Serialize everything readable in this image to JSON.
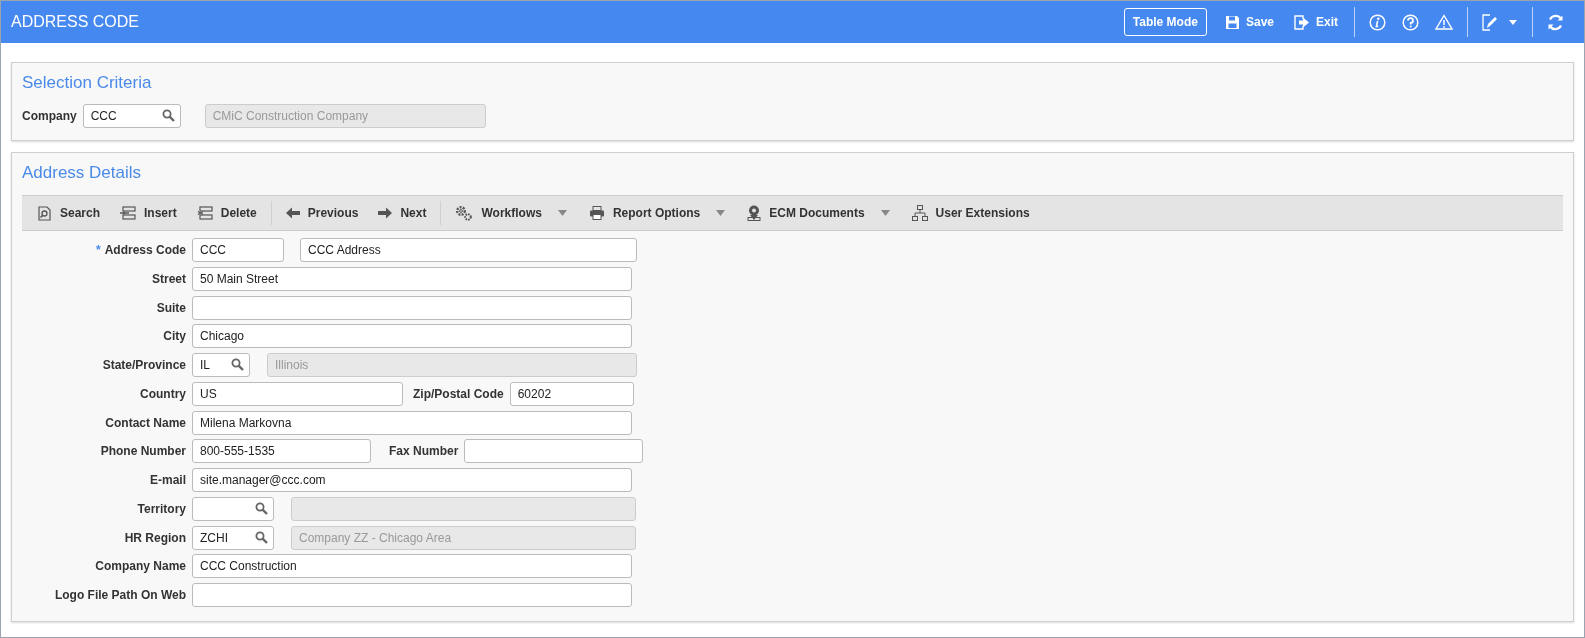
{
  "header": {
    "title": "ADDRESS CODE",
    "actions": [
      {
        "kind": "outlined",
        "label": "Table Mode"
      },
      {
        "kind": "save",
        "label": "Save"
      },
      {
        "kind": "exit",
        "label": "Exit"
      }
    ],
    "icons": [
      {
        "kind": "info"
      },
      {
        "kind": "help"
      },
      {
        "kind": "warning"
      },
      {
        "kind": "edit-menu"
      },
      {
        "kind": "refresh"
      }
    ]
  },
  "selection_criteria": {
    "title": "Selection Criteria",
    "label": "Company",
    "lookup_value": "CCC",
    "description": "CMiC Construction Company"
  },
  "address_details": {
    "title": "Address Details",
    "toolbar": [
      {
        "kind": "search",
        "label": "Search",
        "has_menu": false
      },
      {
        "kind": "insert",
        "label": "Insert",
        "has_menu": false
      },
      {
        "kind": "delete",
        "label": "Delete",
        "has_menu": false
      },
      {
        "kind": "previous",
        "label": "Previous",
        "has_menu": false
      },
      {
        "kind": "next",
        "label": "Next",
        "has_menu": false
      },
      {
        "kind": "workflows",
        "label": "Workflows",
        "has_menu": true
      },
      {
        "kind": "print",
        "label": "Report Options",
        "has_menu": true
      },
      {
        "kind": "documents",
        "label": "ECM Documents",
        "has_menu": true
      },
      {
        "kind": "extensions",
        "label": "User Extensions",
        "has_menu": false
      }
    ],
    "rows": [
      {
        "kind": "pair",
        "label": "Address Code",
        "required_mark": "*",
        "fields": [
          {
            "kind": "text",
            "value": "CCC"
          },
          {
            "kind": "text",
            "value": "CCC Address"
          }
        ]
      },
      {
        "kind": "single",
        "label": "Street",
        "fields": [
          {
            "kind": "text",
            "value": "50 Main Street"
          }
        ]
      },
      {
        "kind": "single",
        "label": "Suite",
        "fields": [
          {
            "kind": "text"
          }
        ]
      },
      {
        "kind": "single",
        "label": "City",
        "fields": [
          {
            "kind": "text",
            "value": "Chicago"
          }
        ]
      },
      {
        "kind": "state",
        "label": "State/Province",
        "fields": [
          {
            "kind": "lookup",
            "value": "IL"
          },
          {
            "kind": "readonly",
            "value": "Illinois"
          }
        ]
      },
      {
        "kind": "split",
        "label": "Country",
        "label_2": "Zip/Postal Code",
        "fields": [
          {
            "kind": "text",
            "value": "US"
          },
          {
            "kind": "text",
            "value": "60202"
          }
        ]
      },
      {
        "kind": "single",
        "label": "Contact Name",
        "fields": [
          {
            "kind": "text",
            "value": "Milena Markovna"
          }
        ]
      },
      {
        "kind": "phone",
        "label": "Phone Number",
        "label_2": "Fax Number",
        "fields": [
          {
            "kind": "text",
            "value": "800-555-1535"
          },
          {
            "kind": "text"
          }
        ]
      },
      {
        "kind": "single",
        "label": "E-mail",
        "fields": [
          {
            "kind": "text",
            "value": "site.manager@ccc.com"
          }
        ]
      },
      {
        "kind": "lookup",
        "label": "Territory",
        "fields": [
          {
            "kind": "lookup"
          },
          {
            "kind": "readonly"
          }
        ]
      },
      {
        "kind": "lookup",
        "label": "HR Region",
        "fields": [
          {
            "kind": "lookup",
            "value": "ZCHI"
          },
          {
            "kind": "readonly",
            "value": "Company ZZ - Chicago Area"
          }
        ]
      },
      {
        "kind": "single",
        "label": "Company Name",
        "fields": [
          {
            "kind": "text",
            "value": "CCC Construction"
          }
        ]
      },
      {
        "kind": "single",
        "label": "Logo File Path On Web",
        "fields": [
          {
            "kind": "text"
          }
        ]
      }
    ]
  }
}
